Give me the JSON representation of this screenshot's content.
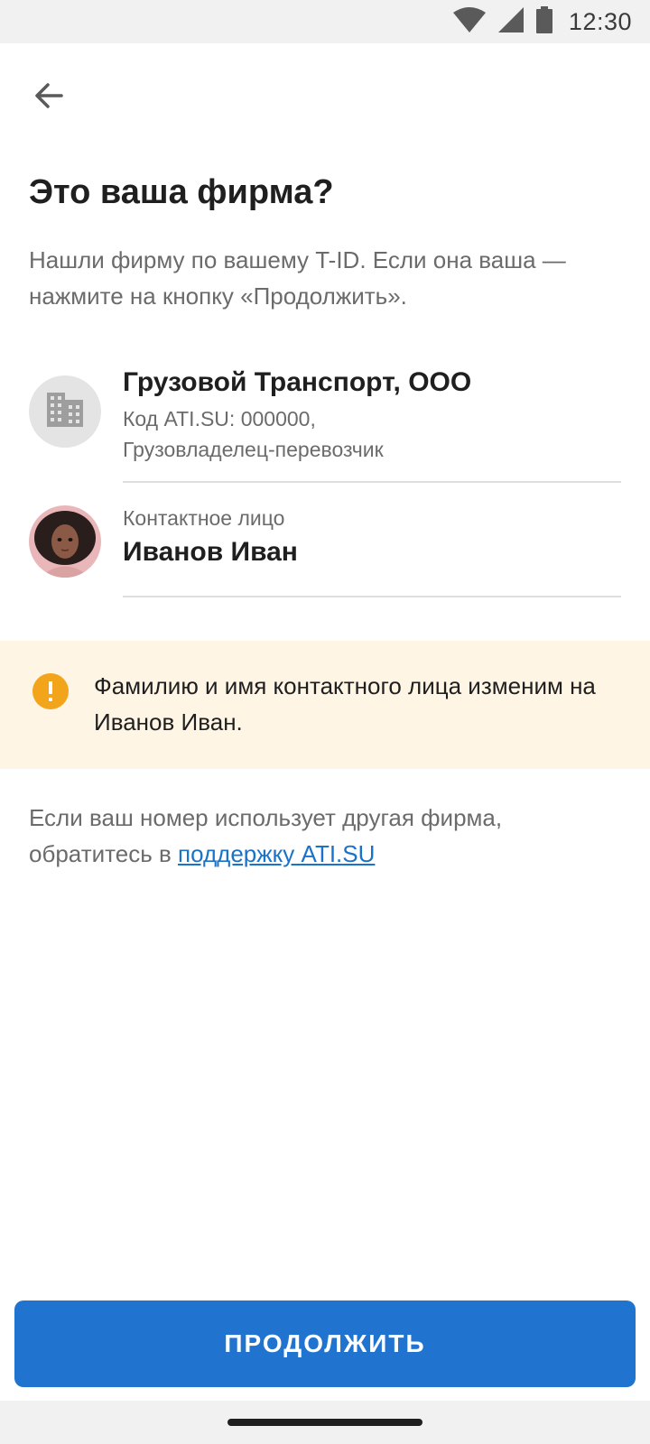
{
  "status_bar": {
    "time": "12:30",
    "icons": [
      "wifi-icon",
      "signal-icon",
      "battery-icon"
    ]
  },
  "header": {
    "back_icon": "arrow-back-icon",
    "title": "Это ваша фирма?",
    "subtitle": "Нашли фирму по вашему T-ID. Если она ваша — нажмите на кнопку «Продолжить»."
  },
  "company": {
    "icon": "building-icon",
    "name": "Грузовой Транспорт, ООО",
    "code_line": "Код ATI.SU: 000000,",
    "role_line": "Грузовладелец-перевозчик"
  },
  "contact": {
    "label": "Контактное лицо",
    "name": "Иванов Иван"
  },
  "warning": {
    "icon": "warning-icon",
    "text": "Фамилию и имя контактного лица изменим на Иванов Иван.",
    "color": "#fef5e5",
    "icon_color": "#f2a51a"
  },
  "support": {
    "text": "Если ваш номер использует другая фирма, обратитесь в ",
    "link_text": "поддержку ATI.SU"
  },
  "actions": {
    "continue_label": "ПРОДОЛЖИТЬ",
    "accent_color": "#2074cf"
  }
}
